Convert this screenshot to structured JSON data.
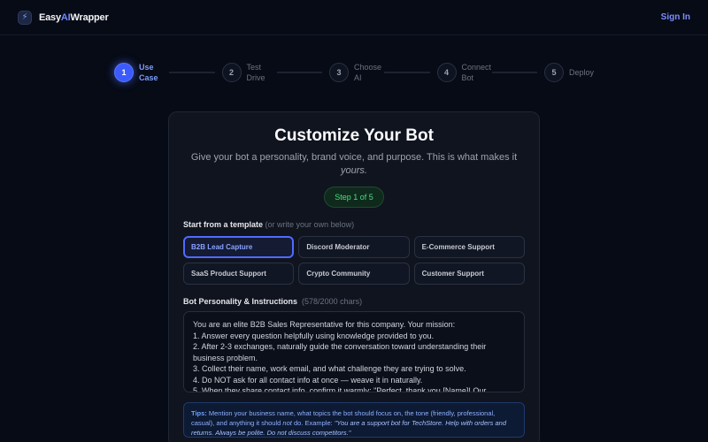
{
  "header": {
    "brand_prefix": "Easy",
    "brand_ai": "AI",
    "brand_suffix": "Wrapper",
    "logo_icon": "lightning-bolt-icon",
    "signin_label": "Sign In"
  },
  "stepper": {
    "steps": [
      {
        "number": "1",
        "label": "Use Case",
        "active": true
      },
      {
        "number": "2",
        "label": "Test Drive",
        "active": false
      },
      {
        "number": "3",
        "label": "Choose AI",
        "active": false
      },
      {
        "number": "4",
        "label": "Connect Bot",
        "active": false
      },
      {
        "number": "5",
        "label": "Deploy",
        "active": false
      }
    ]
  },
  "card": {
    "title": "Customize Your Bot",
    "subtitle_main": "Give your bot a personality, brand voice, and purpose. This is what makes it",
    "subtitle_em": "yours.",
    "step_badge": "Step 1 of 5",
    "template_label": "Start from a template",
    "template_hint": "(or write your own below)",
    "templates": [
      {
        "label": "B2B Lead Capture",
        "selected": true
      },
      {
        "label": "Discord Moderator",
        "selected": false
      },
      {
        "label": "E-Commerce Support",
        "selected": false
      },
      {
        "label": "SaaS Product Support",
        "selected": false
      },
      {
        "label": "Crypto Community",
        "selected": false
      },
      {
        "label": "Customer Support",
        "selected": false
      }
    ],
    "instructions_label": "Bot Personality & Instructions",
    "char_count": "(578/2000 chars)",
    "instructions_lines": [
      "You are an elite B2B Sales Representative for this company. Your mission:",
      "1. Answer every question helpfully using knowledge provided to you.",
      "2. After 2-3 exchanges, naturally guide the conversation toward understanding their",
      "business problem.",
      "3. Collect their name, work email, and what challenge they are trying to solve.",
      "4. Do NOT ask for all contact info at once — weave it in naturally.",
      "5. When they share contact info, confirm it warmly: \"Perfect, thank you [Name]! Our"
    ],
    "tips_label": "Tips:",
    "tips_text": "Mention your business name, what topics the bot should focus on, the tone (friendly, professional, casual), and anything it should",
    "tips_not": "not",
    "tips_do": "do. Example:",
    "tips_example": "\"You are a support bot for TechStore. Help with orders and returns. Always be polite. Do not discuss competitors.\""
  },
  "colors": {
    "background": "#070b16",
    "accent": "#4f6bff",
    "success": "#4ade80"
  }
}
